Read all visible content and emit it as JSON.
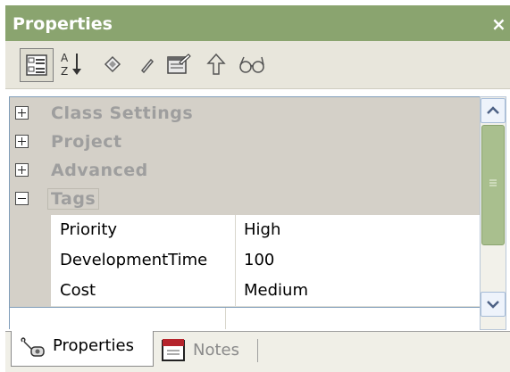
{
  "window": {
    "title": "Properties",
    "close_label": "×"
  },
  "toolbar": {
    "buttons": [
      "categorized-icon",
      "sort-az-icon",
      "diamond-icon",
      "pencil-icon",
      "property-pages-icon",
      "arrow-up-icon",
      "glasses-icon"
    ],
    "sort_az_top": "A",
    "sort_az_bottom": "Z"
  },
  "grid": {
    "categories": [
      {
        "label": "Class Settings",
        "expanded": false
      },
      {
        "label": "Project",
        "expanded": false
      },
      {
        "label": "Advanced",
        "expanded": false
      },
      {
        "label": "Tags",
        "expanded": true
      }
    ],
    "rows": [
      {
        "name": "Priority",
        "value": "High"
      },
      {
        "name": "DevelopmentTime",
        "value": "100"
      },
      {
        "name": "Cost",
        "value": "Medium"
      }
    ]
  },
  "tabs": [
    {
      "label": "Properties",
      "active": true
    },
    {
      "label": "Notes",
      "active": false
    }
  ],
  "colors": {
    "title_bg": "#8aa46f",
    "grid_bg": "#d4d0c8",
    "category_text": "#9e9e9e",
    "scroll_thumb": "#a9bf8e"
  }
}
